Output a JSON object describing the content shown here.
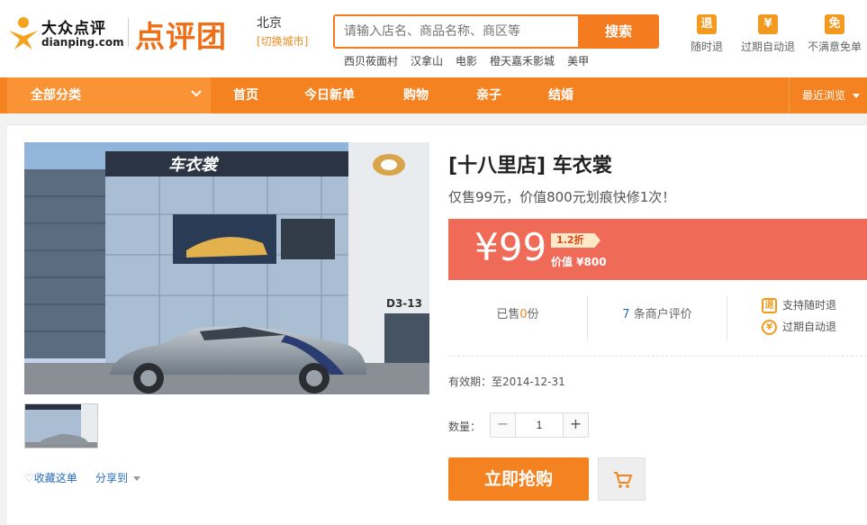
{
  "header": {
    "logo_top": "大众点评",
    "logo_bottom": "dianping.com",
    "tuan_logo": "点评团",
    "city": "北京",
    "city_switch": "[切换城市]",
    "search": {
      "placeholder": "请输入店名、商品名称、商区等",
      "button": "搜索"
    },
    "hot_links": [
      "西贝莜面村",
      "汉拿山",
      "电影",
      "橙天嘉禾影城",
      "美甲"
    ],
    "badges": [
      {
        "icon": "退",
        "label": "随时退"
      },
      {
        "icon": "¥",
        "label": "过期自动退"
      },
      {
        "icon": "免",
        "label": "不满意免单"
      }
    ]
  },
  "nav": {
    "all_categories": "全部分类",
    "items": [
      "首页",
      "今日新单",
      "购物",
      "亲子",
      "结婚"
    ],
    "recent": "最近浏览"
  },
  "deal": {
    "title": "[十八里店] 车衣裳",
    "subtitle": "仅售99元，价值800元划痕快修1次！",
    "price": "¥99",
    "discount": "1.2折",
    "original_price": "价值 ¥800",
    "sold_prefix": "已售",
    "sold_count": "0",
    "sold_suffix": "份",
    "reviews_count": "7",
    "reviews_suffix": "条商户评价",
    "guarantees": [
      "支持随时退",
      "过期自动退"
    ],
    "guarantee_icons": [
      "退",
      "¥"
    ],
    "validity": "有效期：至2014-12-31",
    "quantity_label": "数量：",
    "quantity": "1",
    "buy_label": "立即抢购",
    "favorite": "收藏这单",
    "share": "分享到",
    "store_sign": "车衣裳",
    "building_number": "D3-13"
  },
  "colors": {
    "brand": "#f58220",
    "price_bg": "#ef6b57",
    "link": "#2a6bb8"
  }
}
